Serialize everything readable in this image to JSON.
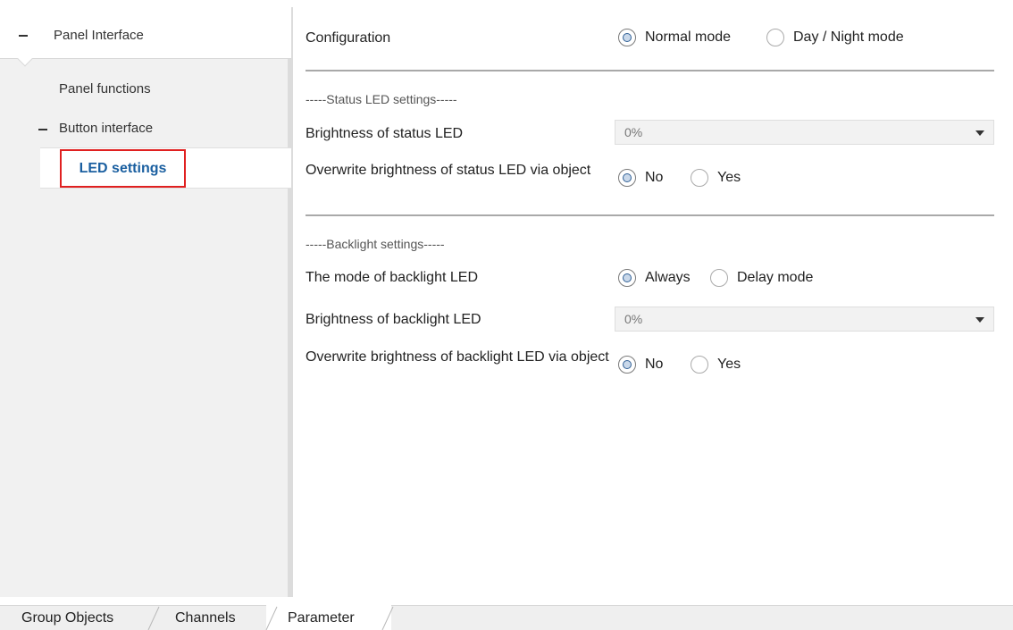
{
  "sidebar": {
    "header": "Panel Interface",
    "items": [
      {
        "label": "Panel functions"
      },
      {
        "label": "Button interface"
      },
      {
        "label": "LED settings"
      }
    ]
  },
  "main": {
    "configuration": {
      "label": "Configuration",
      "options": [
        "Normal mode",
        "Day / Night mode"
      ],
      "selected": "Normal mode"
    },
    "status_section": "-----Status LED settings-----",
    "brightness_status": {
      "label": "Brightness of status LED",
      "value": "0%"
    },
    "overwrite_status": {
      "label": "Overwrite brightness of status LED via object",
      "options": [
        "No",
        "Yes"
      ],
      "selected": "No"
    },
    "backlight_section": "-----Backlight settings-----",
    "backlight_mode": {
      "label": "The mode of backlight LED",
      "options": [
        "Always",
        "Delay mode"
      ],
      "selected": "Always"
    },
    "brightness_backlight": {
      "label": "Brightness of backlight LED",
      "value": "0%"
    },
    "overwrite_backlight": {
      "label": "Overwrite brightness of backlight LED via object",
      "options": [
        "No",
        "Yes"
      ],
      "selected": "No"
    }
  },
  "tabs": [
    {
      "label": "Group Objects"
    },
    {
      "label": "Channels"
    },
    {
      "label": "Parameter"
    }
  ],
  "active_tab": "Parameter",
  "colors": {
    "selected_text": "#1a5fa0",
    "highlight_box": "#e02020"
  }
}
